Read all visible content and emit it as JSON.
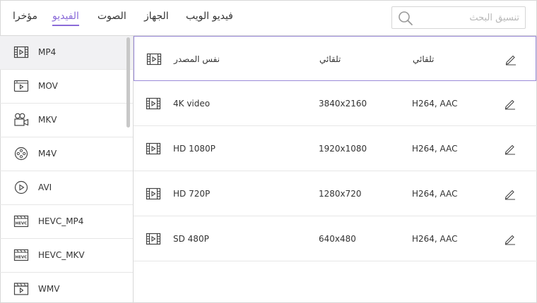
{
  "header": {
    "tabs": [
      {
        "label": "مؤخرا",
        "active": false
      },
      {
        "label": "الفيديو",
        "active": true
      },
      {
        "label": "الصوت",
        "active": false
      },
      {
        "label": "الجهاز",
        "active": false
      },
      {
        "label": "فيديو الويب",
        "active": false
      }
    ],
    "search": {
      "placeholder": "تنسيق البحث",
      "value": ""
    }
  },
  "sidebar": {
    "items": [
      {
        "label": "MP4",
        "icon": "film-icon",
        "selected": true
      },
      {
        "label": "MOV",
        "icon": "video-player-icon"
      },
      {
        "label": "MKV",
        "icon": "video-camera-icon"
      },
      {
        "label": "M4V",
        "icon": "film-reel-icon"
      },
      {
        "label": "AVI",
        "icon": "play-circle-icon"
      },
      {
        "label": "HEVC_MP4",
        "icon": "hevc-icon"
      },
      {
        "label": "HEVC_MKV",
        "icon": "hevc-icon"
      },
      {
        "label": "WMV",
        "icon": "clapperboard-icon"
      }
    ]
  },
  "presets": {
    "rows": [
      {
        "name": "نفس المصدر",
        "resolution": "تلقائي",
        "codec": "تلقائي",
        "selected": true
      },
      {
        "name": "4K video",
        "resolution": "3840x2160",
        "codec": "H264, AAC"
      },
      {
        "name": "HD 1080P",
        "resolution": "1920x1080",
        "codec": "H264, AAC"
      },
      {
        "name": "HD 720P",
        "resolution": "1280x720",
        "codec": "H264, AAC"
      },
      {
        "name": "SD 480P",
        "resolution": "640x480",
        "codec": "H264, AAC"
      }
    ]
  },
  "colors": {
    "accent": "#8a6ad8",
    "selected_border": "#9a8ad8",
    "selected_bg": "#f1f1f3"
  }
}
